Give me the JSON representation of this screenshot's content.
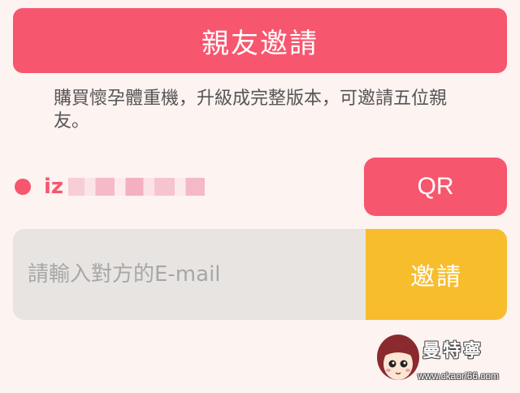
{
  "header": {
    "title": "親友邀請"
  },
  "description": "購買懷孕體重機，升級成完整版本，可邀請五位親友。",
  "friend": {
    "id_prefix": "iz",
    "status_color": "#f7566f"
  },
  "qr_button": {
    "label": "QR"
  },
  "invite": {
    "placeholder": "請輸入對方的E-mail",
    "button_label": "邀請",
    "button_color": "#f8bd2d"
  },
  "watermark": {
    "name": "曼特寧",
    "url": "www.ckaori66.com"
  },
  "colors": {
    "accent": "#f7566f",
    "background": "#fdf3f1"
  }
}
